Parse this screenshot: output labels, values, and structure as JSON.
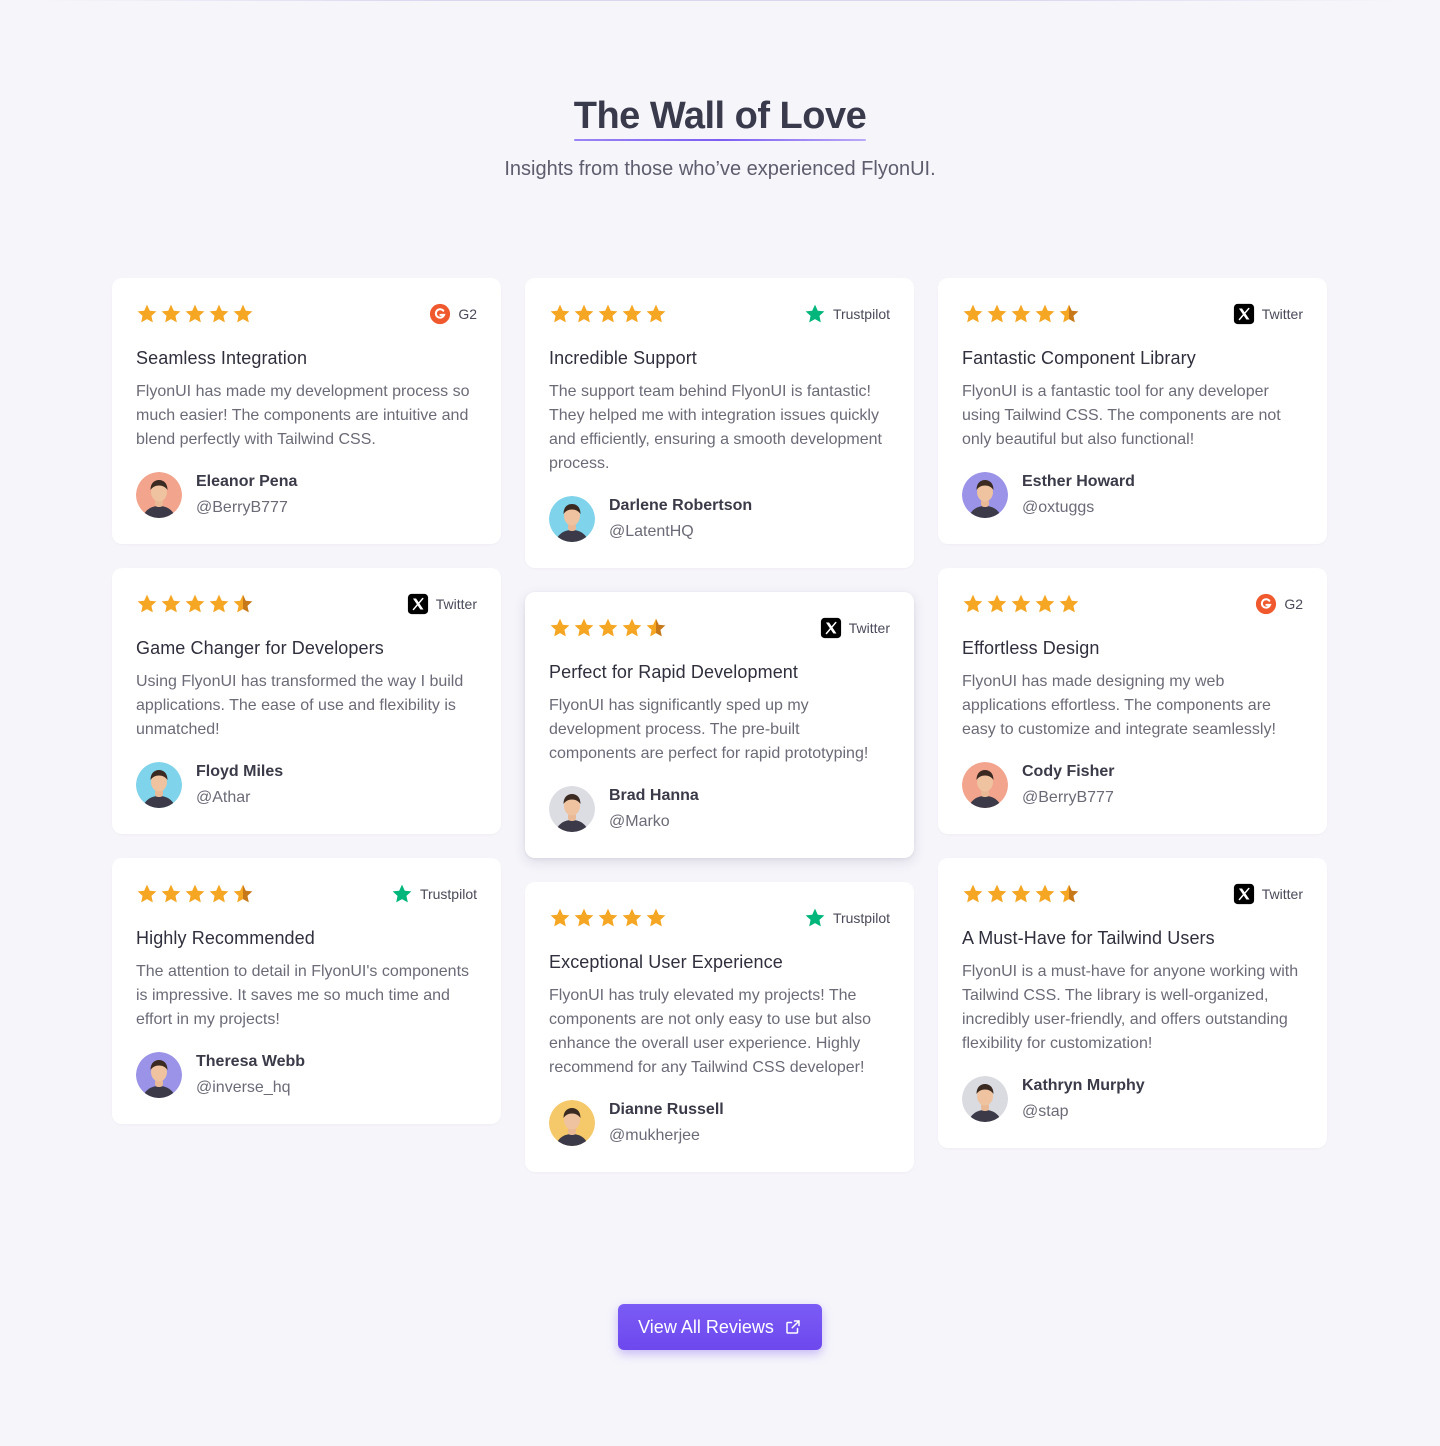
{
  "hero": {
    "title": "The Wall of Love",
    "subtitle": "Insights from those who’ve experienced FlyonUI."
  },
  "colors": {
    "accent": "#7b5cf5",
    "star": "#f5a623",
    "g2": "#f0592e",
    "trustpilot": "#00b67a",
    "twitter": "#000000"
  },
  "columns": [
    [
      {
        "rating": 5,
        "source": "G2",
        "title": "Seamless Integration",
        "body": "FlyonUI has made my development process so much easier! The components are intuitive and blend perfectly with Tailwind CSS.",
        "name": "Eleanor Pena",
        "handle": "@BerryB777",
        "avatar_bg": "#f2a48c",
        "raised": false
      },
      {
        "rating": 4.5,
        "source": "Twitter",
        "title": "Game Changer for Developers",
        "body": "Using FlyonUI has transformed the way I build applications. The ease of use and flexibility is unmatched!",
        "name": "Floyd Miles",
        "handle": "@Athar",
        "avatar_bg": "#7fd3ea",
        "raised": false
      },
      {
        "rating": 4.5,
        "source": "Trustpilot",
        "title": "Highly Recommended",
        "body": "The attention to detail in FlyonUI's components is impressive. It saves me so much time and effort in my projects!",
        "name": "Theresa Webb",
        "handle": "@inverse_hq",
        "avatar_bg": "#9a93e8",
        "raised": false
      }
    ],
    [
      {
        "rating": 5,
        "source": "Trustpilot",
        "title": "Incredible Support",
        "body": "The support team behind FlyonUI is fantastic! They helped me with integration issues quickly and efficiently, ensuring a smooth development process.",
        "name": "Darlene Robertson",
        "handle": "@LatentHQ",
        "avatar_bg": "#7fd3ea",
        "raised": false
      },
      {
        "rating": 4.5,
        "source": "Twitter",
        "title": "Perfect for Rapid Development",
        "body": "FlyonUI has significantly sped up my development process. The pre-built components are perfect for rapid prototyping!",
        "name": "Brad Hanna",
        "handle": "@Marko",
        "avatar_bg": "#dcdde3",
        "raised": true
      },
      {
        "rating": 5,
        "source": "Trustpilot",
        "title": "Exceptional User Experience",
        "body": "FlyonUI has truly elevated my projects! The components are not only easy to use but also enhance the overall user experience. Highly recommend for any Tailwind CSS developer!",
        "name": "Dianne Russell",
        "handle": "@mukherjee",
        "avatar_bg": "#f5c96a",
        "raised": false
      }
    ],
    [
      {
        "rating": 4.5,
        "source": "Twitter",
        "title": "Fantastic Component Library",
        "body": "FlyonUI is a fantastic tool for any developer using Tailwind CSS. The components are not only beautiful but also functional!",
        "name": "Esther Howard",
        "handle": "@oxtuggs",
        "avatar_bg": "#9a93e8",
        "raised": false
      },
      {
        "rating": 5,
        "source": "G2",
        "title": "Effortless Design",
        "body": "FlyonUI has made designing my web applications effortless. The components are easy to customize and integrate seamlessly!",
        "name": "Cody Fisher",
        "handle": "@BerryB777",
        "avatar_bg": "#f2a48c",
        "raised": false
      },
      {
        "rating": 4.5,
        "source": "Twitter",
        "title": "A Must-Have for Tailwind Users",
        "body": "FlyonUI is a must-have for anyone working with Tailwind CSS. The library is well-organized, incredibly user-friendly, and offers outstanding flexibility for customization!",
        "name": "Kathryn Murphy",
        "handle": "@stap",
        "avatar_bg": "#d9dbe0",
        "raised": false
      }
    ]
  ],
  "cta": {
    "label": "View All Reviews",
    "icon": "external-link-icon"
  }
}
